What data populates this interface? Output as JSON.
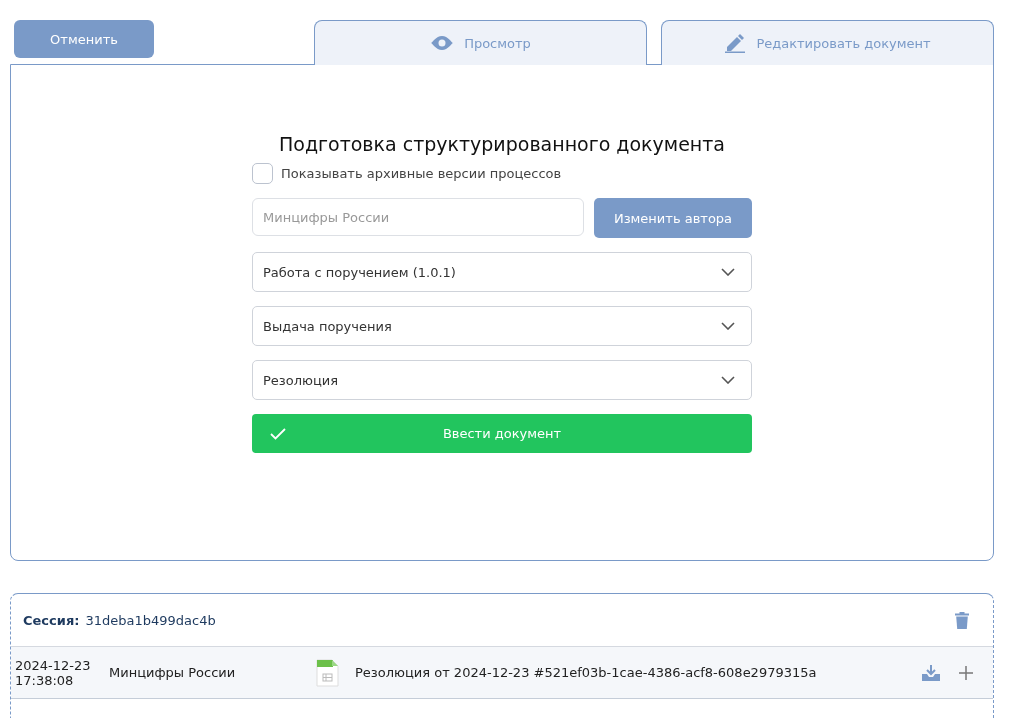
{
  "cancel_button": "Отменить",
  "tabs": [
    {
      "label": "Просмотр",
      "selected": false
    },
    {
      "label": "Редактировать документ",
      "selected": false
    }
  ],
  "form": {
    "title": "Подготовка структурированного документа",
    "archive_checkbox": {
      "label": "Показывать архивные версии процессов",
      "checked": false
    },
    "author_field": {
      "placeholder": "Минцифры России"
    },
    "change_author_button": "Изменить автора",
    "selects": [
      {
        "value": "Работа с поручением (1.0.1)"
      },
      {
        "value": "Выдача поручения"
      },
      {
        "value": "Резолюция"
      }
    ],
    "submit_button": "Ввести документ"
  },
  "session": {
    "label": "Сессия:",
    "id": "31deba1b499dac4b",
    "rows": [
      {
        "date": "2024-12-23",
        "time": "17:38:08",
        "author": "Минцифры России",
        "document": "Резолюция от 2024-12-23 #521ef03b-1cae-4386-acf8-608e2979315a"
      }
    ]
  }
}
